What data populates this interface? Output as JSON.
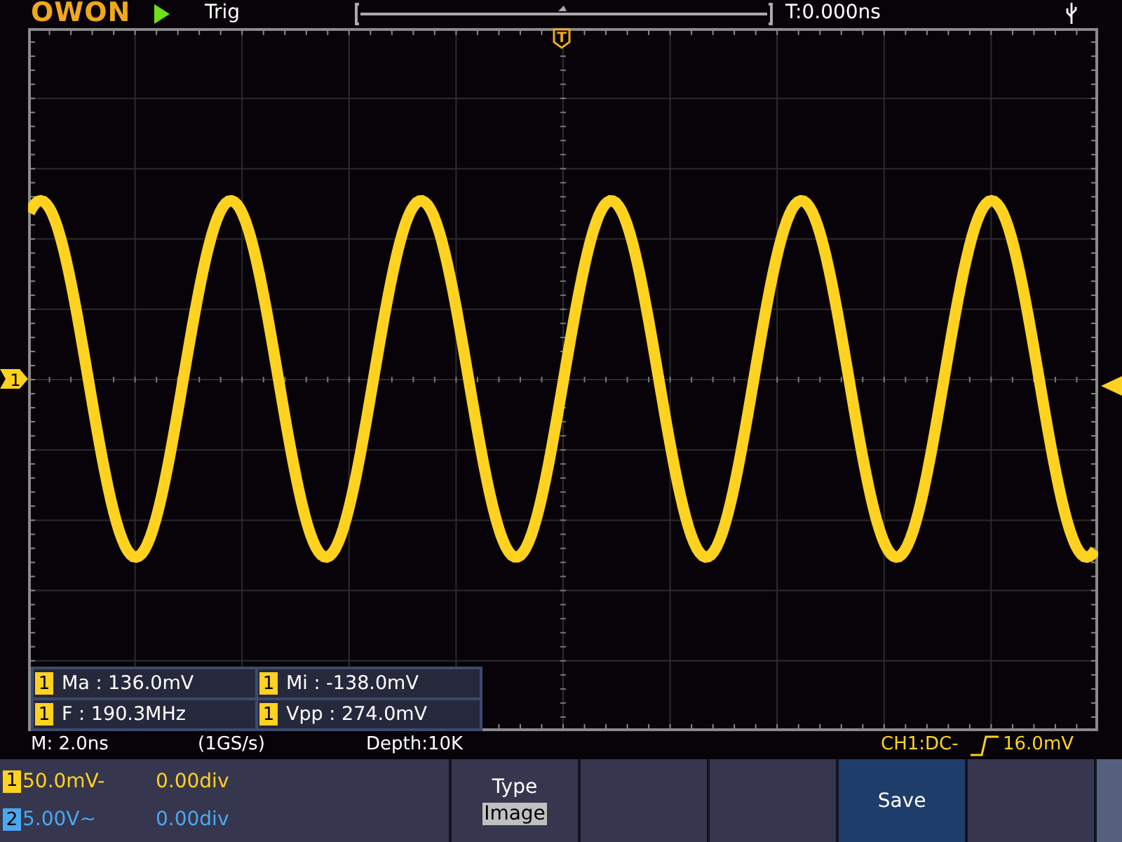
{
  "header": {
    "logo": "OWON",
    "running": true,
    "trigger_status": "Trig",
    "trigger_time": "T:0.000ns"
  },
  "markers": {
    "channel": "1",
    "trigger": "T"
  },
  "measurements": [
    {
      "channel": "1",
      "text": "Ma : 136.0mV"
    },
    {
      "channel": "1",
      "text": "Mi : -138.0mV"
    },
    {
      "channel": "1",
      "text": "F : 190.3MHz"
    },
    {
      "channel": "1",
      "text": "Vpp : 274.0mV"
    }
  ],
  "status": {
    "timebase": "M: 2.0ns",
    "sample_rate": "(1GS/s)",
    "depth": "Depth:10K",
    "trigger_source": "CH1:DC-",
    "trigger_level": "16.0mV"
  },
  "channels": [
    {
      "number": "1",
      "scale": "50.0mV-",
      "offset": "0.00div",
      "color": "#ffd21f"
    },
    {
      "number": "2",
      "scale": "5.00V~",
      "offset": "0.00div",
      "color": "#4aa8f0"
    }
  ],
  "menu": [
    {
      "label": "Type",
      "value": "Image",
      "selected": false
    },
    {
      "selected": false
    },
    {
      "selected": false
    },
    {
      "label": "Save",
      "selected": true
    },
    {
      "selected": false
    }
  ]
}
